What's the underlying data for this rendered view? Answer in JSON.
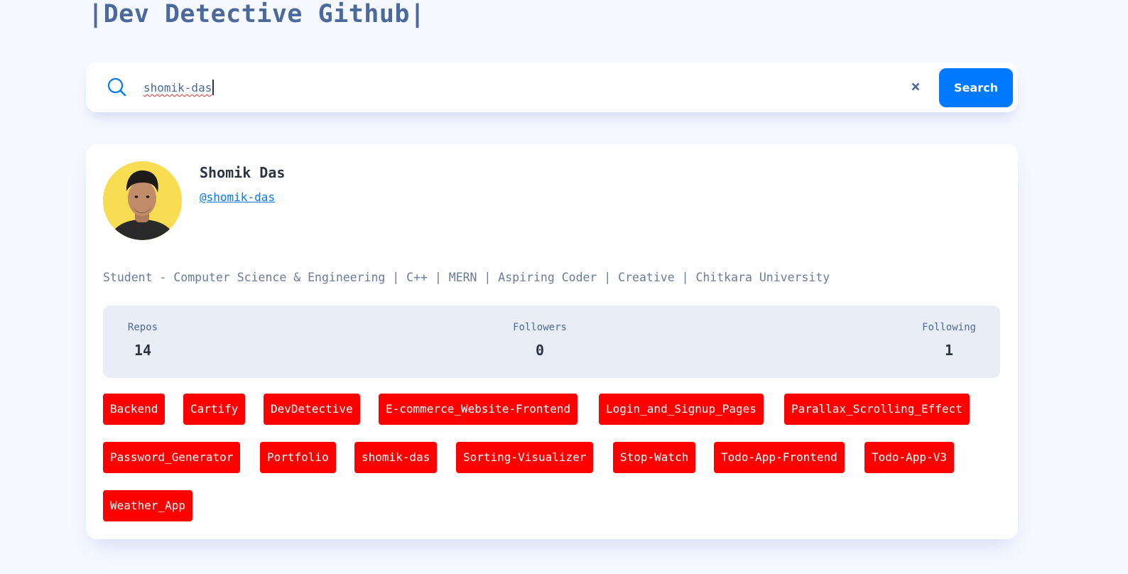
{
  "header": {
    "title": "|Dev Detective Github|"
  },
  "search": {
    "value": "shomik-das",
    "button_label": "Search",
    "clear_label": "×"
  },
  "profile": {
    "name": "Shomik Das",
    "login": "@shomik-das",
    "bio": "Student - Computer Science & Engineering | C++ | MERN | Aspiring Coder | Creative | Chitkara University",
    "stats": [
      {
        "label": "Repos",
        "value": "14"
      },
      {
        "label": "Followers",
        "value": "0"
      },
      {
        "label": "Following",
        "value": "1"
      }
    ],
    "repos": [
      "Backend",
      "Cartify",
      "DevDetective",
      "E-commerce_Website-Frontend",
      "Login_and_Signup_Pages",
      "Parallax_Scrolling_Effect",
      "Password_Generator",
      "Portfolio",
      "shomik-das",
      "Sorting-Visualizer",
      "Stop-Watch",
      "Todo-App-Frontend",
      "Todo-App-V3",
      "Weather_App"
    ]
  },
  "colors": {
    "accent": "#0079ff",
    "repo_tag": "#ff0000",
    "title": "#4b6a9b",
    "background": "#f5f8ff"
  },
  "icons": {
    "search": "search-icon",
    "clear": "close-icon"
  }
}
